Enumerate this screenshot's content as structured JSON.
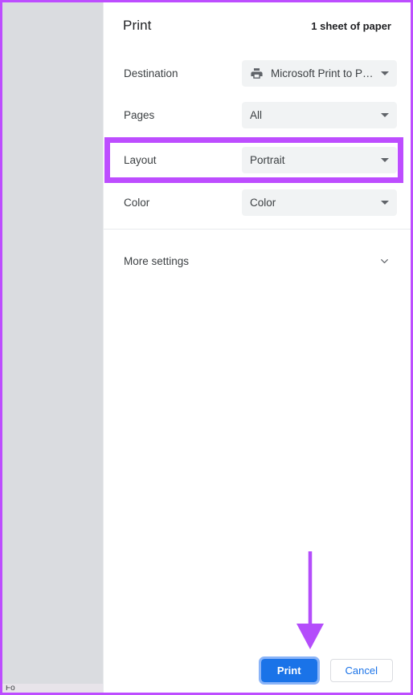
{
  "dialog": {
    "title": "Print",
    "sheet_count": "1 sheet of paper"
  },
  "settings": [
    {
      "key": "destination",
      "label": "Destination",
      "value": "Microsoft Print to PDF",
      "icon": "printer-icon",
      "has_icon": true
    },
    {
      "key": "pages",
      "label": "Pages",
      "value": "All",
      "has_icon": false
    },
    {
      "key": "layout",
      "label": "Layout",
      "value": "Portrait",
      "has_icon": false
    },
    {
      "key": "color",
      "label": "Color",
      "value": "Color",
      "has_icon": false
    }
  ],
  "more_settings": {
    "label": "More settings",
    "icon": "chevron-down-icon"
  },
  "footer": {
    "print_label": "Print",
    "cancel_label": "Cancel"
  },
  "preview": {
    "clipped_text": "Fo"
  },
  "annotations": {
    "highlight_target": "Layout",
    "arrow_target": "Print",
    "highlight_color": "#bd4dff",
    "arrow_color": "#b44dfb",
    "frame_color": "#bd4dff"
  },
  "colors": {
    "accent_blue": "#1a73e8",
    "focus_ring_blue": "#8ab4f8",
    "select_background": "#f1f3f4",
    "preview_background": "#dadce0",
    "text_primary": "#202124",
    "text_secondary": "#3c4043"
  }
}
